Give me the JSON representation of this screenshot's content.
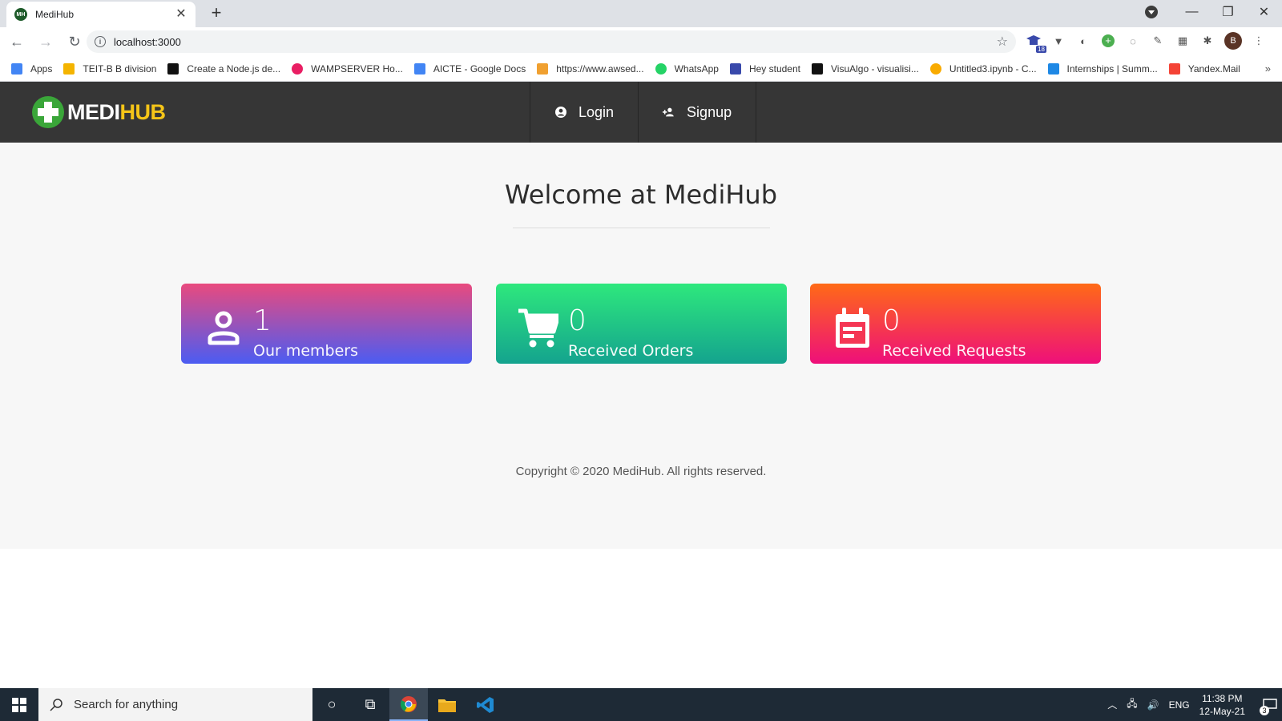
{
  "browser": {
    "tab_title": "MediHub",
    "favicon_text": "MH",
    "url": "localhost:3000",
    "profile_initial": "B",
    "extension_badge": "18",
    "bookmarks": [
      {
        "label": "Apps",
        "color": "#4285f4"
      },
      {
        "label": "TEIT-B B division",
        "color": "#f4b400"
      },
      {
        "label": "Create a Node.js de...",
        "color": "#111111"
      },
      {
        "label": "WAMPSERVER Ho...",
        "color": "#e91e63"
      },
      {
        "label": "AICTE - Google Docs",
        "color": "#4285f4"
      },
      {
        "label": "https://www.awsed...",
        "color": "#f0a030"
      },
      {
        "label": "WhatsApp",
        "color": "#25d366"
      },
      {
        "label": "Hey student",
        "color": "#3949ab"
      },
      {
        "label": "VisuAlgo - visualisi...",
        "color": "#111111"
      },
      {
        "label": "Untitled3.ipynb - C...",
        "color": "#f9ab00"
      },
      {
        "label": "Internships | Summ...",
        "color": "#1e88e5"
      },
      {
        "label": "Yandex.Mail",
        "color": "#f44336"
      }
    ]
  },
  "navbar": {
    "logo_part1": "MEDI",
    "logo_part2": "HUB",
    "login_label": "Login",
    "signup_label": "Signup"
  },
  "main": {
    "heading": "Welcome at MediHub",
    "cards": [
      {
        "value": "1",
        "label": "Our members",
        "icon": "person-icon"
      },
      {
        "value": "0",
        "label": "Received Orders",
        "icon": "cart-icon"
      },
      {
        "value": "0",
        "label": "Received Requests",
        "icon": "calendar-icon"
      }
    ],
    "copyright": "Copyright © 2020 MediHub. All rights reserved."
  },
  "taskbar": {
    "search_placeholder": "Search for anything",
    "language": "ENG",
    "time": "11:38 PM",
    "date": "12-May-21",
    "notification_count": "3"
  },
  "colors": {
    "navbar_bg": "#363636",
    "logo_green": "#3aa639",
    "logo_yellow": "#f5c518",
    "card1": [
      "#e94a7e",
      "#4b5cf2"
    ],
    "card2": [
      "#2ee87d",
      "#14a38e"
    ],
    "card3": [
      "#ff6a16",
      "#ee0f7a"
    ]
  }
}
